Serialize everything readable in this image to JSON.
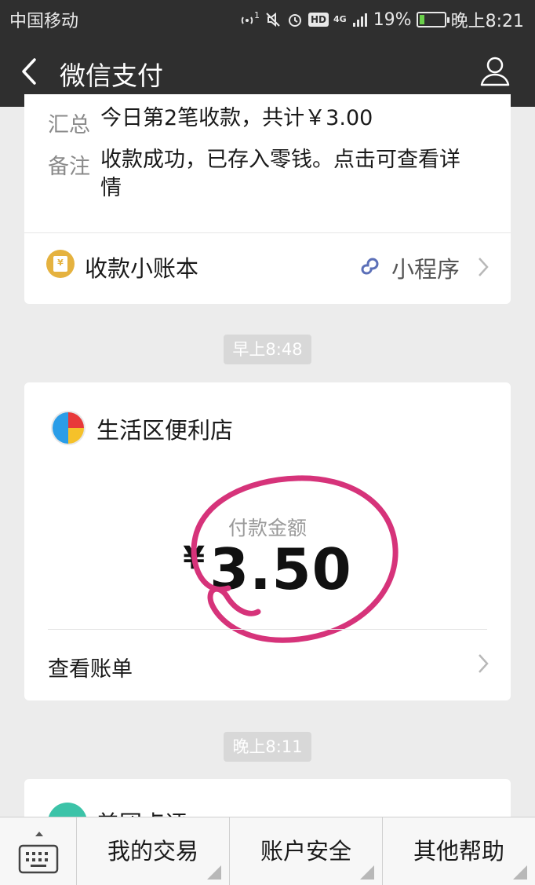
{
  "status_bar": {
    "carrier": "中国移动",
    "hd_badge": "HD",
    "network": "4G",
    "sim_index": "1",
    "battery_percent": "19%",
    "battery_level": 0.19,
    "time": "晚上8:21"
  },
  "nav": {
    "title": "微信支付",
    "back_icon": "chevron-left-icon",
    "user_icon": "user-icon"
  },
  "card1": {
    "summary_label": "汇总",
    "summary_value": "今日第2笔收款，共计￥3.00",
    "note_label": "备注",
    "note_value_line1": "收款成功，已存入零钱。点击可查看详",
    "note_value_line2": "情",
    "ledger_label": "收款小账本",
    "ledger_icon_glyph": "¥",
    "mini_program_label": "小程序"
  },
  "time1": "早上8:48",
  "card2": {
    "store_name": "生活区便利店",
    "amount_label": "付款金额",
    "currency": "¥",
    "amount": "3.50",
    "bill_label": "查看账单",
    "highlight_color": "#d6337a"
  },
  "time2": "晚上8:11",
  "card3": {
    "title": "美团点评"
  },
  "bottom_menu": {
    "keyboard_icon": "keyboard-icon",
    "items": [
      "我的交易",
      "账户安全",
      "其他帮助"
    ]
  },
  "colors": {
    "nav_bg": "#2f2f2f",
    "page_bg": "#ececec",
    "ledger_icon": "#e5b23f",
    "mini_program_icon": "#5b6fb8"
  }
}
